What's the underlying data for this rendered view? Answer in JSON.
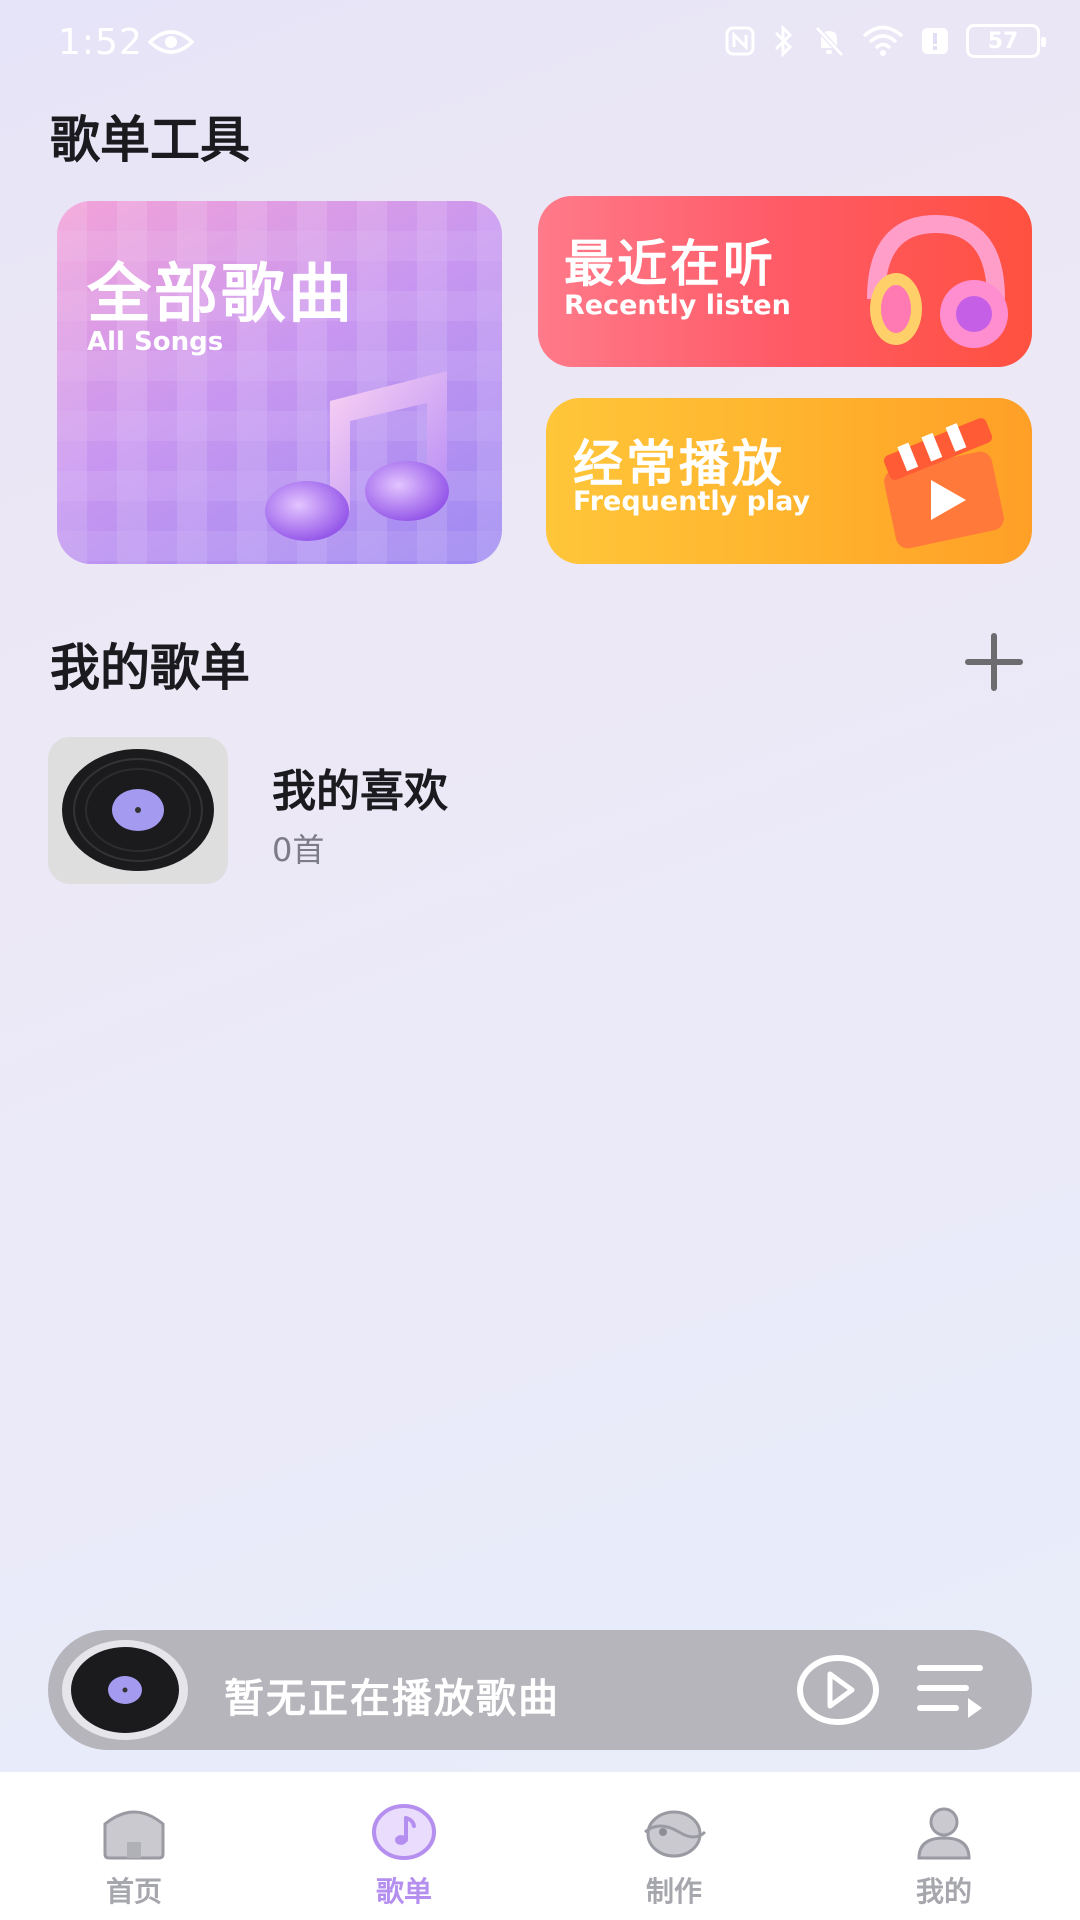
{
  "status_bar": {
    "time": "1:52",
    "battery": "57"
  },
  "tools": {
    "title": "歌单工具",
    "all_songs": {
      "title_cn": "全部歌曲",
      "title_en": "All Songs"
    },
    "recent": {
      "title_cn": "最近在听",
      "title_en": "Recently listen"
    },
    "frequent": {
      "title_cn": "经常播放",
      "title_en": "Frequently play"
    }
  },
  "my_playlists": {
    "title": "我的歌单",
    "items": [
      {
        "name": "我的喜欢",
        "count": "0首"
      }
    ]
  },
  "mini_player": {
    "status_text": "暂无正在播放歌曲"
  },
  "bottom_nav": {
    "items": [
      {
        "label": "首页",
        "icon": "home-icon",
        "active": false
      },
      {
        "label": "歌单",
        "icon": "music-note-icon",
        "active": true
      },
      {
        "label": "制作",
        "icon": "create-icon",
        "active": false
      },
      {
        "label": "我的",
        "icon": "user-icon",
        "active": false
      }
    ]
  },
  "colors": {
    "accent": "#b58ff0",
    "recent_card": "#ff5a66",
    "frequent_card": "#ffb22d",
    "all_songs_card": "#c997f0"
  }
}
